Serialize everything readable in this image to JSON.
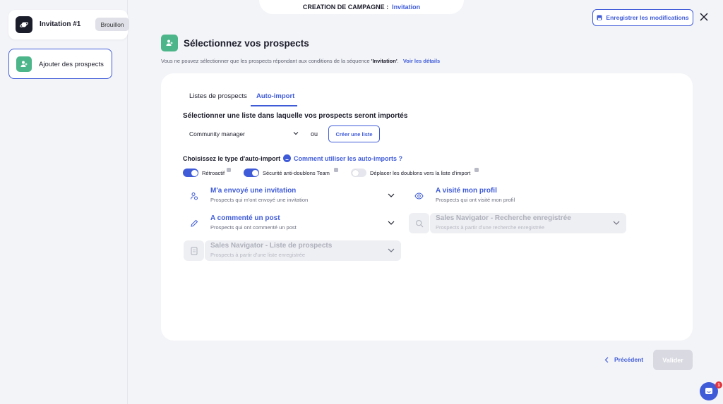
{
  "sidebar": {
    "campaign_name": "Invitation #1",
    "status_badge": "Brouillon",
    "step_label": "Ajouter des prospects"
  },
  "header": {
    "banner_label": "CREATION DE CAMPAGNE :",
    "banner_value": "Invitation",
    "save_label": "Enregistrer les modifications"
  },
  "page": {
    "title": "Sélectionnez vos prospects",
    "subtitle_before": "Vous ne pouvez sélectionner que les prospects répondant aux conditions de la séquence ",
    "subtitle_sequence": "'Invitation'",
    "subtitle_after": ".",
    "details_link": "Voir les détails"
  },
  "tabs": [
    {
      "label": "Listes de prospects",
      "active": false
    },
    {
      "label": "Auto-import",
      "active": true
    }
  ],
  "list_section": {
    "title": "Sélectionner une liste dans laquelle vos prospects seront importés",
    "selected_list": "Community manager",
    "or_label": "ou",
    "create_label": "Créer une liste"
  },
  "import_type": {
    "title": "Choisissez le type d'auto-import",
    "help_link": "Comment utiliser les auto-imports ?",
    "toggles": [
      {
        "label": "Rétroactif",
        "on": true
      },
      {
        "label": "Sécurité anti-doublons Team",
        "on": true
      },
      {
        "label": "Déplacer les doublons vers la liste d'import",
        "on": false
      }
    ],
    "options": [
      {
        "title": "M'a envoyé une invitation",
        "desc": "Prospects qui m'ont envoyé une invitation",
        "icon": "user-invite-icon",
        "enabled": true
      },
      {
        "title": "A visité mon profil",
        "desc": "Prospects qui ont visité mon profil",
        "icon": "eye-icon",
        "enabled": true
      },
      {
        "title": "A commenté un post",
        "desc": "Prospects qui ont commenté un post",
        "icon": "pencil-icon",
        "enabled": true
      },
      {
        "title": "Sales Navigator - Recherche enregistrée",
        "desc": "Prospects à partir d'une recherche enregistrée",
        "icon": "search-icon",
        "enabled": false
      },
      {
        "title": "Sales Navigator - Liste de prospects",
        "desc": "Prospects à partir d'une liste enregistrée",
        "icon": "document-icon",
        "enabled": false
      }
    ]
  },
  "footer": {
    "previous_label": "Précédent",
    "validate_label": "Valider"
  },
  "chat": {
    "badge_count": "1"
  },
  "colors": {
    "accent": "#3f5bd8",
    "green": "#4cb589",
    "disabled": "#d8d9e1"
  }
}
